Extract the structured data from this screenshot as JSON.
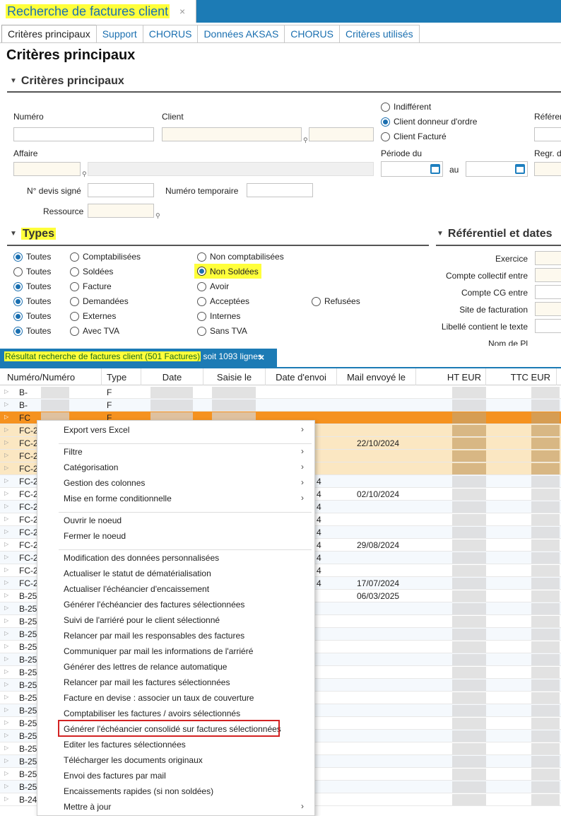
{
  "window": {
    "title": "Recherche de factures client",
    "close": "×"
  },
  "tabs": [
    "Critères principaux",
    "Support",
    "CHORUS",
    "Données AKSAS",
    "CHORUS",
    "Critères utilisés"
  ],
  "page_title": "Critères principaux",
  "section_main": "Critères principaux",
  "fields": {
    "numero": "Numéro",
    "client": "Client",
    "affaire": "Affaire",
    "periode_du": "Période du",
    "au": "au",
    "reference": "Référer",
    "regr": "Regr. d",
    "n_devis": "N° devis signé",
    "num_temp": "Numéro temporaire",
    "ressource": "Ressource"
  },
  "client_radios": [
    "Indifférent",
    "Client donneur d'ordre",
    "Client Facturé"
  ],
  "section_types": "Types",
  "section_ref": "Référentiel et dates",
  "types_rows": [
    [
      "Toutes",
      "Comptabilisées",
      "Non comptabilisées"
    ],
    [
      "Toutes",
      "Soldées",
      "Non Soldées"
    ],
    [
      "Toutes",
      "Facture",
      "Avoir"
    ],
    [
      "Toutes",
      "Demandées",
      "Acceptées",
      "Refusées"
    ],
    [
      "Toutes",
      "Externes",
      "Internes"
    ],
    [
      "Toutes",
      "Avec TVA",
      "Sans TVA"
    ]
  ],
  "ref_labels": [
    "Exercice",
    "Compte collectif entre",
    "Compte CG entre",
    "Site de facturation",
    "Libellé contient le texte",
    "Nom de Pl"
  ],
  "result": {
    "highlight": "Résultat recherche de factures client (501 Factures)",
    "rest": "soit 1093 lignes",
    "close": "×"
  },
  "columns": [
    "Numéro/Numéro",
    "Type",
    "Date",
    "Saisie le",
    "Date d'envoi",
    "Mail envoyé le",
    "HT EUR",
    "TTC EUR"
  ],
  "rows": [
    {
      "num": "B-",
      "type": "F",
      "d4": "",
      "mail": ""
    },
    {
      "num": "B-",
      "type": "F",
      "d4": "",
      "mail": ""
    },
    {
      "num": "FC",
      "type": "F",
      "d4": "",
      "mail": ""
    },
    {
      "num": "FC-2",
      "type": "",
      "d4": "",
      "mail": ""
    },
    {
      "num": "FC-2",
      "type": "",
      "d4": "",
      "mail": "22/10/2024"
    },
    {
      "num": "FC-2",
      "type": "",
      "d4": "",
      "mail": ""
    },
    {
      "num": "FC-2",
      "type": "",
      "d4": "",
      "mail": ""
    },
    {
      "num": "FC-2",
      "type": "",
      "d4": "4",
      "mail": ""
    },
    {
      "num": "FC-2",
      "type": "",
      "d4": "4",
      "mail": "02/10/2024"
    },
    {
      "num": "FC-2",
      "type": "",
      "d4": "4",
      "mail": ""
    },
    {
      "num": "FC-2",
      "type": "",
      "d4": "4",
      "mail": ""
    },
    {
      "num": "FC-2",
      "type": "",
      "d4": "4",
      "mail": ""
    },
    {
      "num": "FC-2",
      "type": "",
      "d4": "4",
      "mail": "29/08/2024"
    },
    {
      "num": "FC-2",
      "type": "",
      "d4": "4",
      "mail": ""
    },
    {
      "num": "FC-2",
      "type": "",
      "d4": "4",
      "mail": ""
    },
    {
      "num": "FC-2",
      "type": "",
      "d4": "4",
      "mail": "17/07/2024"
    },
    {
      "num": "B-25",
      "type": "",
      "d4": "",
      "mail": "06/03/2025"
    },
    {
      "num": "B-25",
      "type": "",
      "d4": "",
      "mail": ""
    },
    {
      "num": "B-25",
      "type": "",
      "d4": "",
      "mail": ""
    },
    {
      "num": "B-25",
      "type": "",
      "d4": "",
      "mail": ""
    },
    {
      "num": "B-25",
      "type": "",
      "d4": "",
      "mail": ""
    },
    {
      "num": "B-25",
      "type": "",
      "d4": "",
      "mail": ""
    },
    {
      "num": "B-25",
      "type": "",
      "d4": "",
      "mail": ""
    },
    {
      "num": "B-25",
      "type": "",
      "d4": "",
      "mail": ""
    },
    {
      "num": "B-25",
      "type": "",
      "d4": "",
      "mail": ""
    },
    {
      "num": "B-25",
      "type": "",
      "d4": "",
      "mail": ""
    },
    {
      "num": "B-25",
      "type": "",
      "d4": "",
      "mail": ""
    },
    {
      "num": "B-25",
      "type": "",
      "d4": "",
      "mail": ""
    },
    {
      "num": "B-25",
      "type": "",
      "d4": "",
      "mail": ""
    },
    {
      "num": "B-25",
      "type": "",
      "d4": "",
      "mail": ""
    },
    {
      "num": "B-25",
      "type": "",
      "d4": "",
      "mail": ""
    },
    {
      "num": "B-25",
      "type": "",
      "d4": "",
      "mail": ""
    },
    {
      "num": "B-24",
      "type": "",
      "d4": "",
      "mail": ""
    }
  ],
  "menu": [
    {
      "label": "Export vers Excel",
      "sub": true
    },
    {
      "sep": true
    },
    {
      "label": "Filtre",
      "sub": true
    },
    {
      "label": "Catégorisation",
      "sub": true
    },
    {
      "label": "Gestion des colonnes",
      "sub": true
    },
    {
      "label": "Mise en forme conditionnelle",
      "sub": true
    },
    {
      "sep": true
    },
    {
      "label": "Ouvrir le noeud"
    },
    {
      "label": "Fermer le noeud"
    },
    {
      "sep": true
    },
    {
      "label": "Modification des données personnalisées"
    },
    {
      "label": "Actualiser le statut de dématérialisation"
    },
    {
      "label": "Actualiser l'échéancier d'encaissement"
    },
    {
      "label": "Générer l'échéancier des factures sélectionnées"
    },
    {
      "label": "Suivi de l'arriéré pour le client sélectionné"
    },
    {
      "label": "Relancer par mail les responsables des factures"
    },
    {
      "label": "Communiquer par mail les informations de l'arriéré"
    },
    {
      "label": "Générer des lettres de relance automatique"
    },
    {
      "label": "Relancer par mail les factures sélectionnées"
    },
    {
      "label": "Facture en devise : associer un taux de couverture"
    },
    {
      "label": "Comptabiliser les factures / avoirs sélectionnés"
    },
    {
      "label": "Générer l'échéancier consolidé sur factures sélectionnées",
      "highlight": true
    },
    {
      "label": "Editer les factures sélectionnées"
    },
    {
      "label": "Télécharger les documents originaux"
    },
    {
      "label": "Envoi des factures par mail"
    },
    {
      "label": "Encaissements rapides (si non soldées)"
    },
    {
      "label": "Mettre à jour",
      "sub": true
    }
  ],
  "chevron": "›"
}
